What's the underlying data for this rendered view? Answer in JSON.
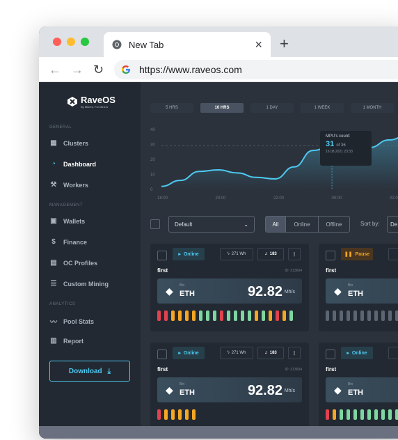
{
  "browser": {
    "tab_title": "New Tab",
    "tab_close": "×",
    "new_tab": "+",
    "url": "https://www.raveos.com",
    "nav": {
      "back": "←",
      "forward": "→",
      "reload": "↻"
    }
  },
  "brand": {
    "name": "RaveOS",
    "tagline": "By Miners, For Miners"
  },
  "sidebar": {
    "sections": {
      "general": "GENERAL",
      "management": "MANAGEMENT",
      "analytics": "ANALYTICS"
    },
    "items": [
      {
        "label": "Clusters",
        "icon": "clusters-icon"
      },
      {
        "label": "Dashboard",
        "icon": "dashboard-icon"
      },
      {
        "label": "Workers",
        "icon": "workers-icon"
      },
      {
        "label": "Wallets",
        "icon": "wallet-icon"
      },
      {
        "label": "Finance",
        "icon": "dollar-icon"
      },
      {
        "label": "OC Profiles",
        "icon": "oc-profiles-icon"
      },
      {
        "label": "Custom Mining",
        "icon": "sliders-icon"
      },
      {
        "label": "Pool Stats",
        "icon": "pool-stats-icon"
      },
      {
        "label": "Report",
        "icon": "report-icon"
      }
    ],
    "download_label": "Download"
  },
  "ranges": [
    "5 HRS",
    "10 HRS",
    "1 DAY",
    "1 WEEK",
    "1 MONTH"
  ],
  "active_range": "10 HRS",
  "chart_data": {
    "type": "area",
    "x_ticks": [
      "18:00",
      "20:00",
      "22:00",
      "00:00",
      "02:00"
    ],
    "y_ticks": [
      0,
      10,
      20,
      30,
      40
    ],
    "ylim": [
      0,
      40
    ],
    "series": [
      {
        "values": [
          2,
          6,
          12,
          13,
          11,
          8,
          7,
          15,
          26,
          29,
          31,
          28,
          33,
          36
        ]
      }
    ],
    "highlight_index": 9,
    "color": "#4ec9f0",
    "tooltip": {
      "label": "MPU's count:",
      "value": "31",
      "of": "of 36",
      "date": "16.08.2021 23:33"
    }
  },
  "filters": {
    "select_value": "Default",
    "status_tabs": [
      "All",
      "Online",
      "Offline"
    ],
    "active_status": "All",
    "sort_label": "Sort by:",
    "sort_value": "De"
  },
  "cards": [
    {
      "status": "Online",
      "power": "271 Wh",
      "count": "183",
      "name": "first",
      "id": "ID: 313694",
      "pool": "Bin",
      "coin": "ETH",
      "hashrate": "92.82",
      "unit": "Mh/s",
      "bars": [
        "#e0424f",
        "#e0424f",
        "#f5a623",
        "#f5a623",
        "#f5a623",
        "#f5a623",
        "#7ed6a0",
        "#7ed6a0",
        "#7ed6a0",
        "#e0424f",
        "#7ed6a0",
        "#7ed6a0",
        "#7ed6a0",
        "#7ed6a0",
        "#f5a623",
        "#7ed6a0",
        "#f5a623",
        "#e0424f",
        "#f5a623",
        "#7ed6a0"
      ]
    },
    {
      "status": "Pause",
      "name": "first",
      "pool": "Bin",
      "coin": "ETH",
      "bars": [
        "#5c6673",
        "#5c6673",
        "#5c6673",
        "#5c6673",
        "#5c6673",
        "#5c6673",
        "#5c6673",
        "#5c6673",
        "#5c6673",
        "#5c6673",
        "#5c6673",
        "#5c6673",
        "#5c6673",
        "#5c6673"
      ]
    },
    {
      "status": "Online",
      "power": "271 Wh",
      "count": "183",
      "name": "first",
      "id": "ID: 313694",
      "pool": "Bin",
      "coin": "ETH",
      "hashrate": "92.82",
      "unit": "Mh/s",
      "bars": [
        "#e0424f",
        "#f5a623",
        "#f5a623",
        "#f5a623",
        "#f5a623",
        "#f5a623"
      ]
    },
    {
      "status": "Online",
      "name": "first",
      "pool": "Bin",
      "coin": "ETH",
      "bars": [
        "#e0424f",
        "#f5a623",
        "#7ed6a0",
        "#7ed6a0",
        "#7ed6a0",
        "#7ed6a0",
        "#7ed6a0",
        "#7ed6a0",
        "#7ed6a0",
        "#7ed6a0",
        "#7ed6a0",
        "#7ed6a0",
        "#7ed6a0",
        "#7ed6a0"
      ]
    }
  ]
}
